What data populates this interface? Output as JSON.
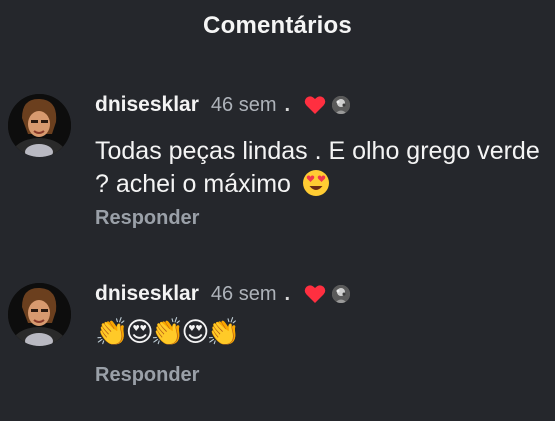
{
  "header": {
    "title": "Comentários"
  },
  "comments": [
    {
      "username": "dnisesklar",
      "time": "46 sem",
      "dot": ".",
      "text": "Todas peças lindas . E olho grego verde ? achei o máximo",
      "text_emoji": "😍",
      "reply_label": "Responder",
      "liked_by_author": true
    },
    {
      "username": "dnisesklar",
      "time": "46 sem",
      "dot": ".",
      "text": "👏😍👏😍👏",
      "reply_label": "Responder",
      "liked_by_author": true
    }
  ],
  "colors": {
    "background": "#25272c",
    "heart": "#ff2f40",
    "muted": "#9aa0a8"
  }
}
